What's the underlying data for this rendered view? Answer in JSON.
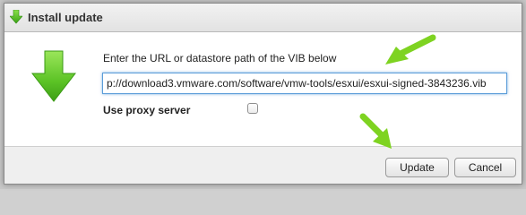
{
  "dialog": {
    "title": "Install update",
    "prompt": "Enter the URL or datastore path of the VIB below",
    "url_value": "p://download3.vmware.com/software/vmw-tools/esxui/esxui-signed-3843236.vib",
    "proxy_label": "Use proxy server",
    "proxy_checked": false,
    "title_icon": "download-arrow-icon",
    "main_icon": "download-arrow-icon"
  },
  "footer": {
    "update_label": "Update",
    "cancel_label": "Cancel"
  },
  "colors": {
    "accent_green": "#5fc01f",
    "highlight_arrow": "#7ed321",
    "focus_blue": "#5b9dd9"
  },
  "annotations": {
    "arrow_icon": "annotation-arrow-icon"
  }
}
